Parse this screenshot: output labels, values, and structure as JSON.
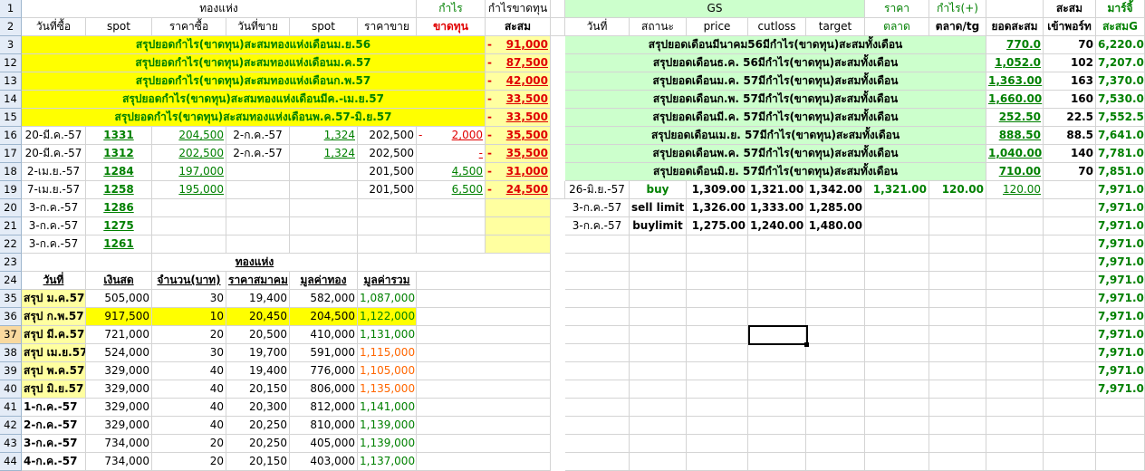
{
  "row_numbers": [
    "1",
    "2",
    "3",
    "12",
    "13",
    "14",
    "15",
    "16",
    "17",
    "18",
    "19",
    "20",
    "21",
    "22",
    "23",
    "24",
    "35",
    "36",
    "37",
    "38",
    "39",
    "40",
    "41",
    "42",
    "43",
    "44"
  ],
  "selected_row": "37",
  "left_header": {
    "title_gold": "ทองแห่ง",
    "profit_label": "กำไร",
    "cum_profit_label": "กำไรขาดทุน",
    "cols": [
      "วันที่ซื้อ",
      "spot",
      "ราคาซื้อ",
      "วันที่ขาย",
      "spot",
      "ราคาขาย",
      "ขาดทุน",
      "สะสม"
    ]
  },
  "summary_rows": [
    {
      "label": "สรุปยอดกำไร(ขาดทุน)สะสมทองแห่งเดือนม.ย.56",
      "amount": "91,000"
    },
    {
      "label": "สรุปยอดกำไร(ขาดทุน)สะสมทองแห่งเดือนม.ค.57",
      "amount": "87,500"
    },
    {
      "label": "สรุปยอดกำไร(ขาดทุน)สะสมทองแห่งเดือนก.พ.57",
      "amount": "42,000"
    },
    {
      "label": "สรุปยอดกำไร(ขาดทุน)สะสมทองแห่งเดือนมีค.-เม.ย.57",
      "amount": "33,500"
    },
    {
      "label": "สรุปยอดกำไร(ขาดทุน)สะสมทองแห่งเดือนพ.ค.57-มิ.ย.57",
      "amount": "33,500"
    }
  ],
  "trade_rows": [
    {
      "date": "20-มี.ค.-57",
      "spot": "1331",
      "buy": "204,500",
      "sdate": "2-ก.ค.-57",
      "sspot": "1,324",
      "sell": "202,500",
      "loss": "2,000",
      "cum": "35,500"
    },
    {
      "date": "20-มี.ค.-57",
      "spot": "1312",
      "buy": "202,500",
      "sdate": "2-ก.ค.-57",
      "sspot": "1,324",
      "sell": "202,500",
      "loss": "-",
      "cum": "35,500"
    },
    {
      "date": "2-เม.ย.-57",
      "spot": "1284",
      "buy": "197,000",
      "sdate": "",
      "sspot": "",
      "sell": "201,500",
      "loss": "4,500",
      "cum": "31,000"
    },
    {
      "date": "7-เม.ย.-57",
      "spot": "1258",
      "buy": "195,000",
      "sdate": "",
      "sspot": "",
      "sell": "201,500",
      "loss": "6,500",
      "cum": "24,500"
    },
    {
      "date": "3-ก.ค.-57",
      "spot": "1286",
      "buy": "",
      "sdate": "",
      "sspot": "",
      "sell": "",
      "loss": "",
      "cum": ""
    },
    {
      "date": "3-ก.ค.-57",
      "spot": "1275",
      "buy": "",
      "sdate": "",
      "sspot": "",
      "sell": "",
      "loss": "",
      "cum": ""
    },
    {
      "date": "3-ก.ค.-57",
      "spot": "1261",
      "buy": "",
      "sdate": "",
      "sspot": "",
      "sell": "",
      "loss": "",
      "cum": ""
    }
  ],
  "minus_sign": "-",
  "bar_section": {
    "title": "ทองแห่ง",
    "cols": [
      "วันที่",
      "เงินสด",
      "จำนวน(บาท)",
      "ราคาสมาคม",
      "มูลค่าทอง",
      "มูลค่ารวม"
    ]
  },
  "bar_rows": [
    {
      "date": "สรุป ม.ค.57",
      "cash": "505,000",
      "qty": "30",
      "price": "19,400",
      "gold": "582,000",
      "total": "1,087,000",
      "tc": "g"
    },
    {
      "date": "สรุป ก.พ.57",
      "cash": "917,500",
      "qty": "10",
      "price": "20,450",
      "gold": "204,500",
      "total": "1,122,000",
      "tc": "g"
    },
    {
      "date": "สรุป มี.ค.57",
      "cash": "721,000",
      "qty": "20",
      "price": "20,500",
      "gold": "410,000",
      "total": "1,131,000",
      "tc": "g"
    },
    {
      "date": "สรุป เม.ย.57",
      "cash": "524,000",
      "qty": "30",
      "price": "19,700",
      "gold": "591,000",
      "total": "1,115,000",
      "tc": "or"
    },
    {
      "date": "สรุป พ.ค.57",
      "cash": "329,000",
      "qty": "40",
      "price": "19,400",
      "gold": "776,000",
      "total": "1,105,000",
      "tc": "or"
    },
    {
      "date": "สรุป มิ.ย.57",
      "cash": "329,000",
      "qty": "40",
      "price": "20,150",
      "gold": "806,000",
      "total": "1,135,000",
      "tc": "or"
    },
    {
      "date": "1-ก.ค.-57",
      "cash": "329,000",
      "qty": "40",
      "price": "20,300",
      "gold": "812,000",
      "total": "1,141,000",
      "tc": "g"
    },
    {
      "date": "2-ก.ค.-57",
      "cash": "329,000",
      "qty": "40",
      "price": "20,250",
      "gold": "810,000",
      "total": "1,139,000",
      "tc": "g"
    },
    {
      "date": "3-ก.ค.-57",
      "cash": "734,000",
      "qty": "20",
      "price": "20,250",
      "gold": "405,000",
      "total": "1,139,000",
      "tc": "g"
    },
    {
      "date": "4-ก.ค.-57",
      "cash": "734,000",
      "qty": "20",
      "price": "20,150",
      "gold": "403,000",
      "total": "1,137,000",
      "tc": "g"
    }
  ],
  "right_header": {
    "gs": "GS",
    "price_label": "ราคา",
    "profit_plus": "กำไร(+)",
    "cum": "สะสม",
    "margin": "มาร์จิ้",
    "cols": [
      "วันที่",
      "สถานะ",
      "price",
      "cutloss",
      "target",
      "ตลาด",
      "ตลาด/tg",
      "ยอดสะสม",
      "เข้าพอร์ท",
      "สะสมG"
    ]
  },
  "gs_summary": [
    {
      "label": "สรุปยอดเดือนมีนาคม56มีกำไร(ขาดทุน)สะสมทั้งเดือน",
      "val": "770.0",
      "port": "70",
      "marg": "6,220.0"
    },
    {
      "label": "สรุปยอดเดือนธ.ค. 56มีกำไร(ขาดทุน)สะสมทั้งเดือน",
      "val": "1,052.0",
      "port": "102",
      "marg": "7,207.0"
    },
    {
      "label": "สรุปยอดเดือนม.ค. 57มีกำไร(ขาดทุน)สะสมทั้งเดือน",
      "val": "1,363.00",
      "port": "163",
      "marg": "7,370.0"
    },
    {
      "label": "สรุปยอดเดือนก.พ. 57มีกำไร(ขาดทุน)สะสมทั้งเดือน",
      "val": "1,660.00",
      "port": "160",
      "marg": "7,530.0"
    },
    {
      "label": "สรุปยอดเดือนมี.ค. 57มีกำไร(ขาดทุน)สะสมทั้งเดือน",
      "val": "252.50",
      "port": "22.5",
      "marg": "7,552.5"
    },
    {
      "label": "สรุปยอดเดือนเม.ย. 57มีกำไร(ขาดทุน)สะสมทั้งเดือน",
      "val": "888.50",
      "port": "88.5",
      "marg": "7,641.0"
    },
    {
      "label": "สรุปยอดเดือนพ.ค. 57มีกำไร(ขาดทุน)สะสมทั้งเดือน",
      "val": "1,040.00",
      "port": "140",
      "marg": "7,781.0"
    },
    {
      "label": "สรุปยอดเดือนมิ.ย. 57มีกำไร(ขาดทุน)สะสมทั้งเดือน",
      "val": "710.00",
      "port": "70",
      "marg": "7,851.0"
    }
  ],
  "gs_trades": [
    {
      "date": "26-มิ.ย.-57",
      "status": "buy",
      "price": "1,309.00",
      "cut": "1,321.00",
      "target": "1,342.00",
      "mkt": "1,321.00",
      "tg": "120.00",
      "cum": "120.00",
      "marg": "7,971.0"
    },
    {
      "date": "3-ก.ค.-57",
      "status": "sell limit",
      "price": "1,326.00",
      "cut": "1,333.00",
      "target": "1,285.00",
      "mkt": "",
      "tg": "",
      "cum": "",
      "marg": "7,971.0"
    },
    {
      "date": "3-ก.ค.-57",
      "status": "buylimit",
      "price": "1,275.00",
      "cut": "1,240.00",
      "target": "1,480.00",
      "mkt": "",
      "tg": "",
      "cum": "",
      "marg": "7,971.0"
    }
  ],
  "marg_repeat": "7,971.0"
}
